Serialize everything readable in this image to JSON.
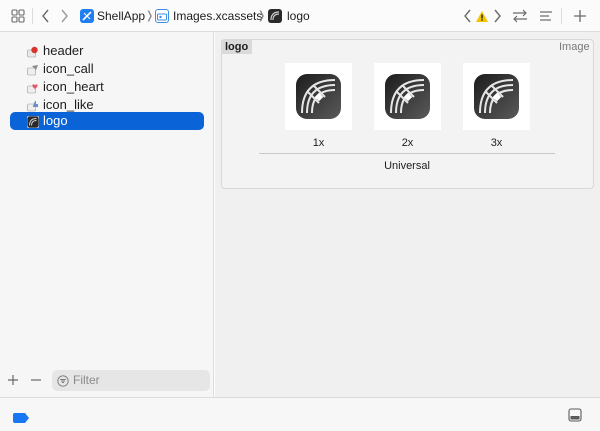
{
  "toolbar": {
    "breadcrumb": [
      {
        "label": "ShellApp",
        "icon": "app-project-icon"
      },
      {
        "label": "Images.xcassets",
        "icon": "asset-catalog-icon"
      },
      {
        "label": "logo",
        "icon": "image-set-icon"
      }
    ],
    "icons": [
      "grid-icon",
      "back-icon",
      "forward-icon",
      "warning-icon",
      "swap-icon",
      "lines-icon",
      "add-icon"
    ],
    "warning_color": "#f5c400"
  },
  "sidebar": {
    "items": [
      {
        "label": "header",
        "icon": "header-icon"
      },
      {
        "label": "icon_call",
        "icon": "call-icon"
      },
      {
        "label": "icon_heart",
        "icon": "heart-icon"
      },
      {
        "label": "icon_like",
        "icon": "like-icon"
      },
      {
        "label": "logo",
        "icon": "logo-icon",
        "selected": true
      }
    ],
    "filter_placeholder": "Filter"
  },
  "editor": {
    "set_name": "logo",
    "set_type": "Image",
    "slots": [
      "1x",
      "2x",
      "3x"
    ],
    "group_label": "Universal"
  },
  "colors": {
    "selection": "#0a64d8",
    "status_tag": "#1778f2"
  }
}
